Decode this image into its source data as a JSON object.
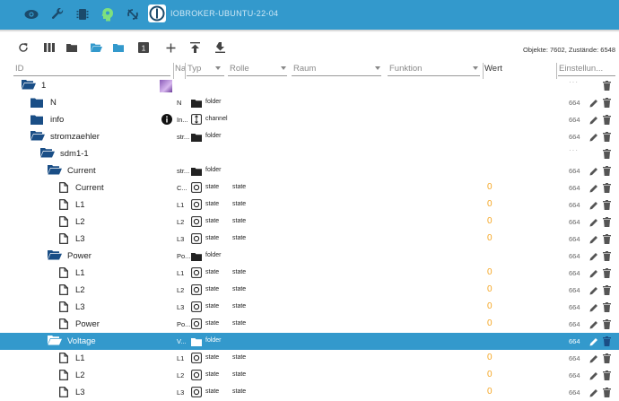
{
  "host": "IOBROKER-UBUNTU-22-04",
  "toolbar": {
    "counts": "Objekte: 7602, Zustände: 6548"
  },
  "columns": {
    "id": "ID",
    "name": "Na",
    "type": "Typ",
    "role": "Rolle",
    "room": "Raum",
    "function": "Funktion",
    "value": "Wert",
    "settings": "Einstellun..."
  },
  "rows": [
    {
      "name": "1",
      "abbr": "",
      "type": "",
      "role": "",
      "value": "",
      "acl": ""
    },
    {
      "name": "N",
      "abbr": "N",
      "type": "folder",
      "role": "",
      "value": "",
      "acl": "664"
    },
    {
      "name": "info",
      "abbr": "In...",
      "type": "channel",
      "role": "",
      "value": "",
      "acl": "664"
    },
    {
      "name": "stromzaehler",
      "abbr": "str...",
      "type": "folder",
      "role": "",
      "value": "",
      "acl": "664"
    },
    {
      "name": "sdm1-1",
      "abbr": "",
      "type": "",
      "role": "",
      "value": "",
      "acl": ""
    },
    {
      "name": "Current",
      "abbr": "str...",
      "type": "folder",
      "role": "",
      "value": "",
      "acl": "664"
    },
    {
      "name": "Current",
      "abbr": "C...",
      "type": "state",
      "role": "state",
      "value": "0",
      "acl": "664"
    },
    {
      "name": "L1",
      "abbr": "L1",
      "type": "state",
      "role": "state",
      "value": "0",
      "acl": "664"
    },
    {
      "name": "L2",
      "abbr": "L2",
      "type": "state",
      "role": "state",
      "value": "0",
      "acl": "664"
    },
    {
      "name": "L3",
      "abbr": "L3",
      "type": "state",
      "role": "state",
      "value": "0",
      "acl": "664"
    },
    {
      "name": "Power",
      "abbr": "Po...",
      "type": "folder",
      "role": "",
      "value": "",
      "acl": "664"
    },
    {
      "name": "L1",
      "abbr": "L1",
      "type": "state",
      "role": "state",
      "value": "0",
      "acl": "664"
    },
    {
      "name": "L2",
      "abbr": "L2",
      "type": "state",
      "role": "state",
      "value": "0",
      "acl": "664"
    },
    {
      "name": "L3",
      "abbr": "L3",
      "type": "state",
      "role": "state",
      "value": "0",
      "acl": "664"
    },
    {
      "name": "Power",
      "abbr": "Po...",
      "type": "state",
      "role": "state",
      "value": "0",
      "acl": "664"
    },
    {
      "name": "Voltage",
      "abbr": "V...",
      "type": "folder",
      "role": "",
      "value": "",
      "acl": "664"
    },
    {
      "name": "L1",
      "abbr": "L1",
      "type": "state",
      "role": "state",
      "value": "0",
      "acl": "664"
    },
    {
      "name": "L2",
      "abbr": "L2",
      "type": "state",
      "role": "state",
      "value": "0",
      "acl": "664"
    },
    {
      "name": "L3",
      "abbr": "L3",
      "type": "state",
      "role": "state",
      "value": "0",
      "acl": "664"
    }
  ],
  "colors": {
    "accent": "#3399cc",
    "folder": "#1a4e86",
    "value": "#f5a623"
  }
}
